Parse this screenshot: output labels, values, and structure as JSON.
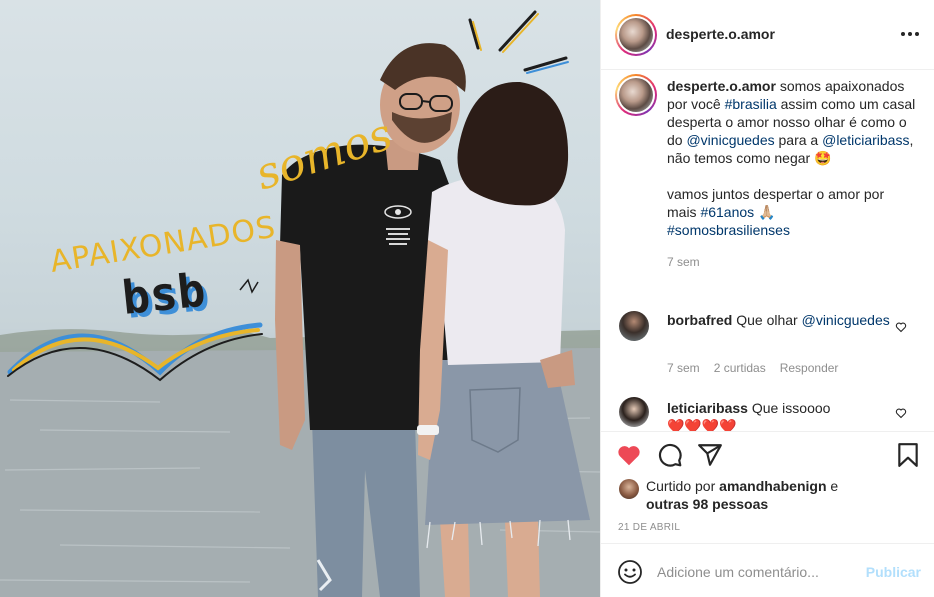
{
  "post": {
    "username": "desperte.o.amor",
    "more_icon": "more-horizontal-icon"
  },
  "media": {
    "overlay_line1": "somos",
    "overlay_line2": "APAIXONADOS",
    "overlay_line3": "bsb",
    "shirt_text": "se teus olhos forem bons, todo o teu corpo terá luz",
    "colors": {
      "sky": "#d4dfe3",
      "water": "#a9b2b5",
      "accent_yellow": "#e8b52a",
      "ink": "#1d1d1d",
      "line_blue": "#3e8fd8"
    }
  },
  "caption": {
    "username": "desperte.o.amor",
    "text_1": " somos apaixonados por você ",
    "tag_brasilia": "#brasilia",
    "text_2": " assim como um casal desperta o amor nosso olhar é como o do ",
    "mention_1": "@vinicguedes",
    "text_3": " para a ",
    "mention_2": "@leticiaribass",
    "text_4": ", não temos como negar 🤩",
    "text_5": "vamos juntos despertar o amor por mais ",
    "tag_61": "#61anos",
    "text_6": " 🙏🏼",
    "tag_somos": "#somosbrasilienses",
    "time": "7 sem"
  },
  "comments": [
    {
      "username": "borbafred",
      "text": " Que olhar ",
      "mention": "@vinicguedes",
      "time": "7 sem",
      "likes": "2 curtidas",
      "reply": "Responder"
    },
    {
      "username": "leticiaribass",
      "text": " Que issoooo",
      "emoji": "❤️❤️❤️❤️"
    }
  ],
  "actions": {
    "liked_prefix": "Curtido por ",
    "liked_user": "amandhabenign",
    "liked_mid": " e",
    "liked_others": "outras 98 pessoas",
    "date": "21 DE ABRIL",
    "icons": [
      "heart-filled-icon",
      "comment-icon",
      "share-icon",
      "bookmark-icon"
    ],
    "like_color": "#ed4956"
  },
  "add_comment": {
    "placeholder": "Adicione um comentário...",
    "publish_label": "Publicar",
    "publish_color": "#b2dffc"
  }
}
